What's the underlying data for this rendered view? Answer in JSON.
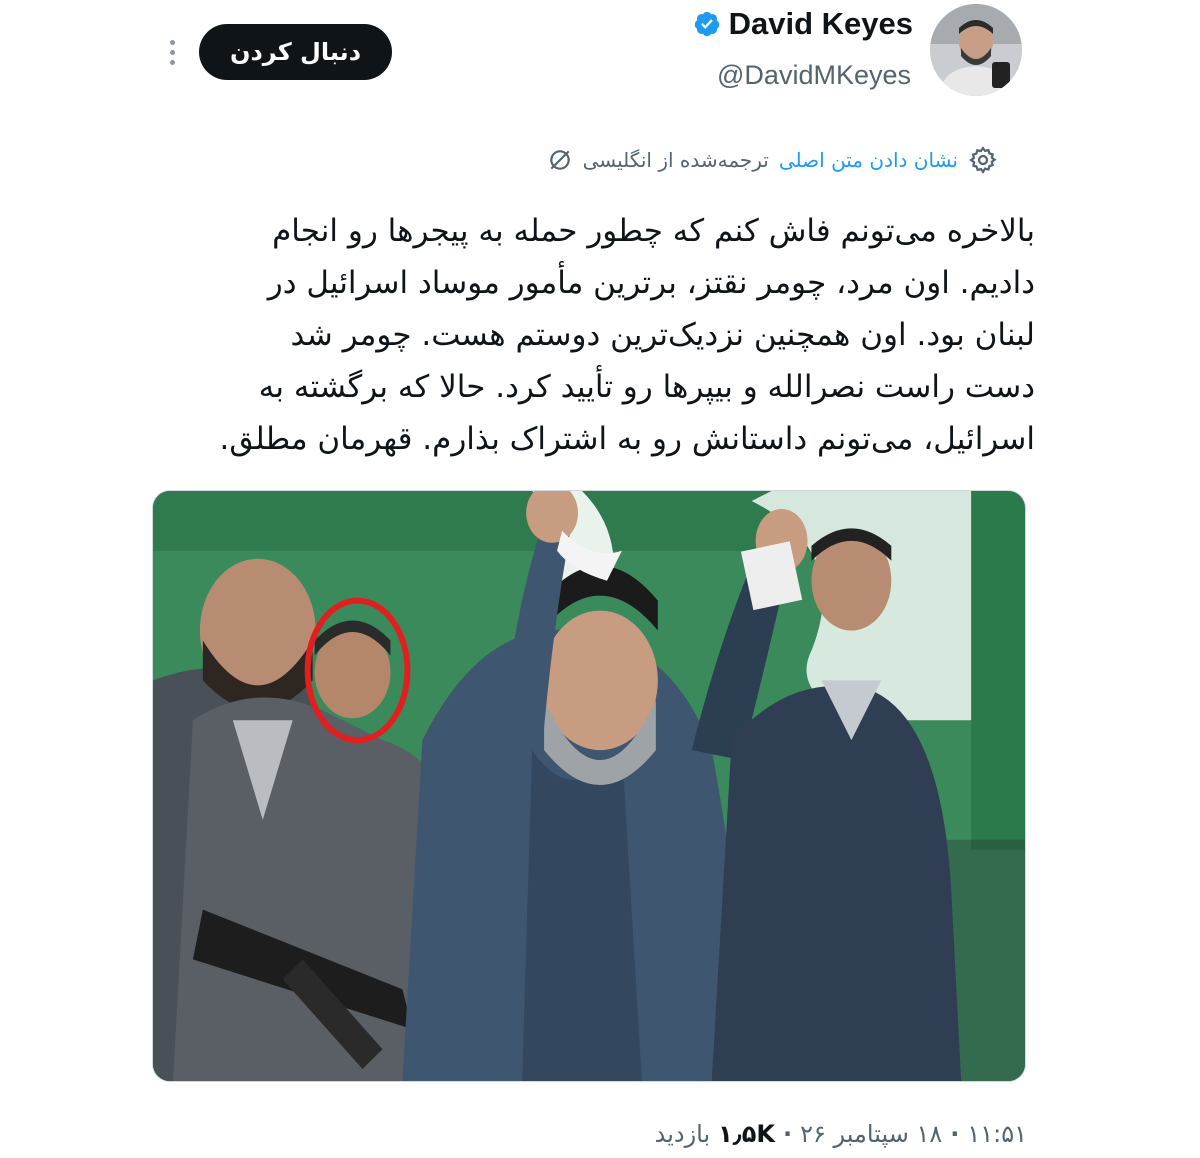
{
  "header": {
    "display_name": "David Keyes",
    "handle": "@DavidMKeyes",
    "follow_label": "دنبال کردن",
    "verified_color": "#1d9bf0"
  },
  "translation": {
    "from_label": "ترجمه‌شده از انگلیسی",
    "show_original_label": "نشان دادن متن اصلی",
    "link_color": "#1d9bf0"
  },
  "tweet": {
    "lines": [
      "بالاخره می‌تونم فاش کنم که چطور حمله به پیجرها رو انجام",
      "دادیم. اون مرد، چومر نقتز، برترین مأمور موساد اسرائیل در",
      "لبنان بود. اون همچنین نزدیک‌ترین دوستم هست. چومر شد",
      "دست راست نصرالله و بیپرها رو تأیید کرد. حالا که برگشته به",
      "اسرائیل، می‌تونم داستانش رو به اشتراک بذارم. قهرمان مطلق."
    ]
  },
  "meta": {
    "time": "۱۱:۵۱",
    "date": "۱۸ سپتامبر ۲۶",
    "views_count": "۱٫۵K",
    "views_label": "بازدید"
  },
  "icons": {
    "more": "more-vertical-icon",
    "verified": "verified-badge-icon",
    "translate": "translate-icon",
    "settings": "settings-gear-icon"
  }
}
